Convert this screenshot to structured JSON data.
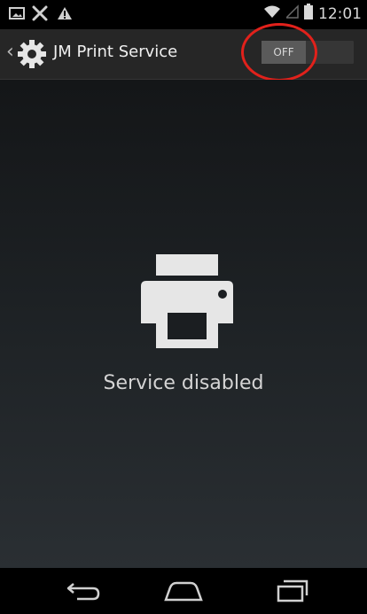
{
  "status_bar": {
    "time": "12:01",
    "notification_icons": [
      "image-icon",
      "tools-icon",
      "warning-icon"
    ],
    "system_icons": [
      "wifi-icon",
      "signal-icon",
      "battery-icon"
    ]
  },
  "action_bar": {
    "title": "JM Print Service",
    "toggle_label": "OFF",
    "toggle_state": "off"
  },
  "content": {
    "empty_message": "Service disabled",
    "icon": "printer-icon"
  },
  "nav_bar": {
    "buttons": [
      "back-icon",
      "home-icon",
      "recent-apps-icon"
    ]
  },
  "colors": {
    "annotation_ring": "#e1211b",
    "action_bar_bg": "#262626",
    "toggle_thumb": "#5a5a5a",
    "icon_color": "#e6e6e6"
  }
}
